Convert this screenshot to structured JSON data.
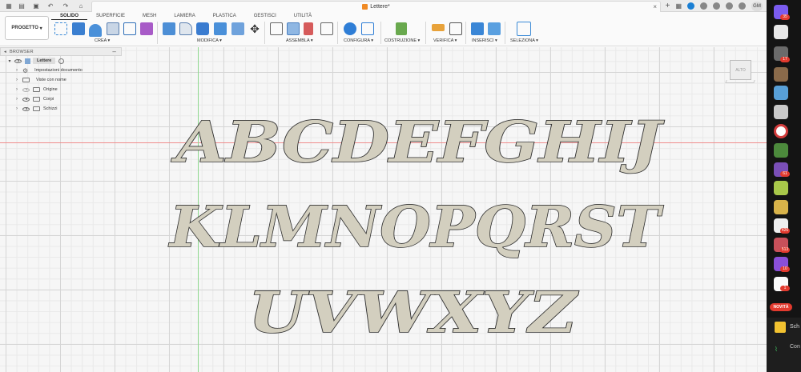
{
  "window": {
    "document_title": "Lettere*"
  },
  "topbar": {
    "avatar_initials": "GM",
    "icons": [
      "file-menu-icon",
      "save-icon",
      "undo-icon",
      "redo-icon",
      "home-icon",
      "close-tab-icon",
      "new-tab-icon",
      "notifications-icon",
      "help-icon"
    ]
  },
  "ribbon": {
    "project_label": "PROGETTO",
    "tabs": [
      "SOLIDO",
      "SUPERFICIE",
      "MESH",
      "LAMIERA",
      "PLASTICA",
      "GESTISCI",
      "UTILITÀ"
    ],
    "active_tab": "SOLIDO",
    "groups": [
      "CREA",
      "MODIFICA",
      "ASSEMBLA",
      "CONFIGURA",
      "COSTRUZIONE",
      "VERIFICA",
      "INSERISCI",
      "SELEZIONA"
    ]
  },
  "browser": {
    "title": "BROWSER",
    "root": "Lettere",
    "items": [
      "Impostazioni documento",
      "Viste con nome",
      "Origine",
      "Corpi",
      "Schizzi"
    ]
  },
  "viewcube": {
    "label": "ALTO"
  },
  "canvas": {
    "letter_rows": [
      "ABCDEFGHIJ",
      "KLMNOPQRST",
      "UVWXYZ"
    ],
    "letter_fill": "#d3cfbf",
    "letter_stroke": "#2f2f2f"
  },
  "sidebar": {
    "badges": [
      "35",
      "17",
      "61",
      "426",
      "513",
      "10",
      "1"
    ],
    "novita_label": "NOVITÀ",
    "panel_text_1": "Sch",
    "panel_text_2": "Con"
  }
}
